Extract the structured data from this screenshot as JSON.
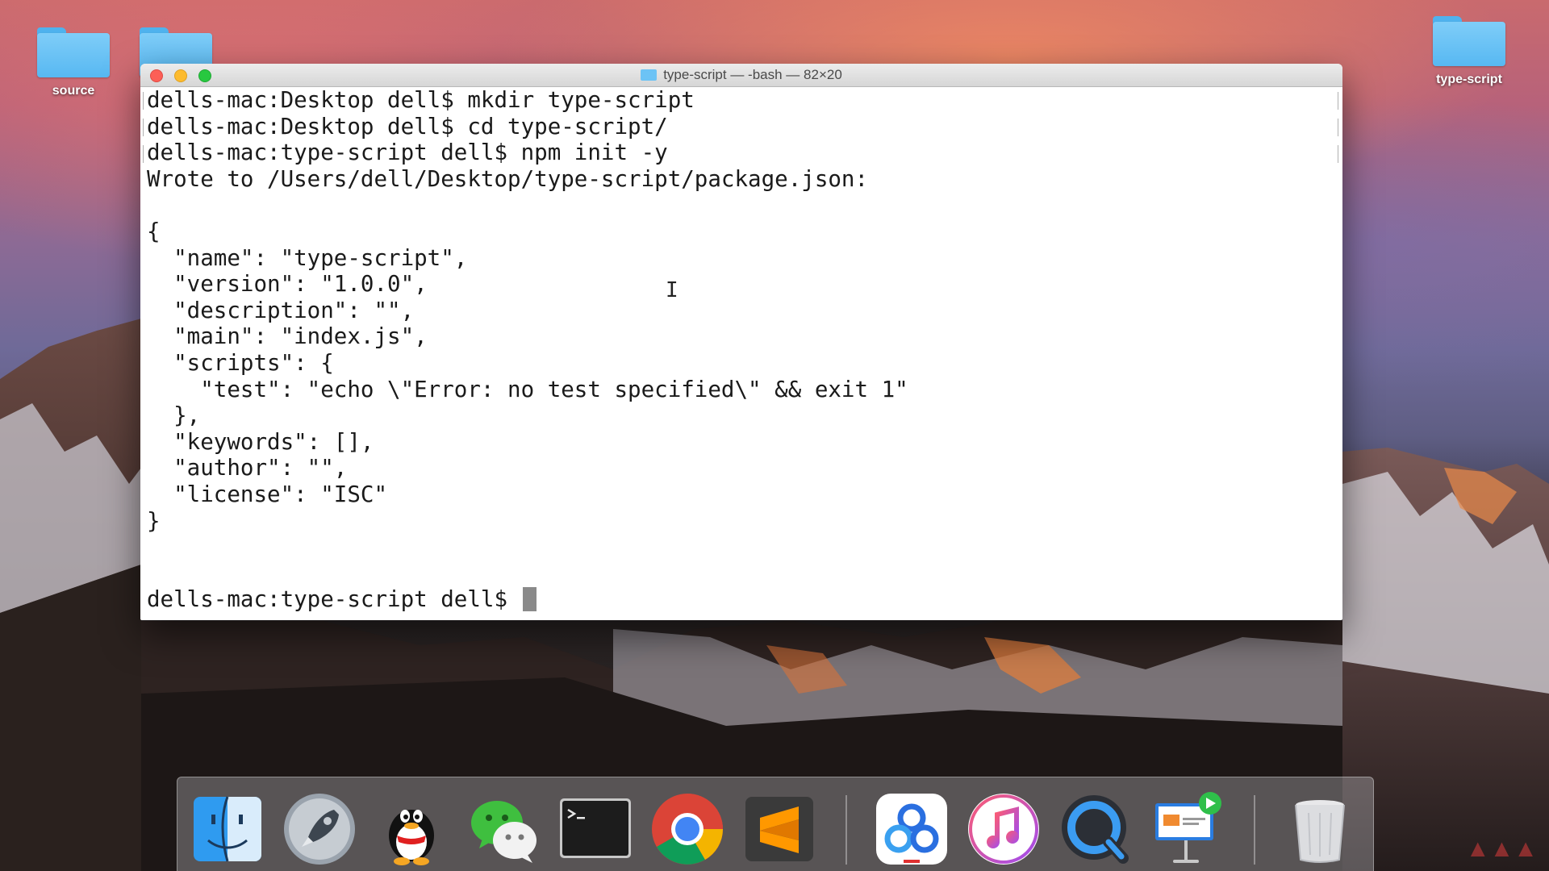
{
  "desktop": {
    "icons": [
      {
        "label": "source",
        "icon": "folder-icon"
      },
      {
        "label": "",
        "icon": "folder-icon"
      },
      {
        "label": "type-script",
        "icon": "folder-icon"
      }
    ]
  },
  "terminal": {
    "title": "type-script — -bash — 82×20",
    "lines": [
      "dells-mac:Desktop dell$ mkdir type-script",
      "dells-mac:Desktop dell$ cd type-script/",
      "dells-mac:type-script dell$ npm init -y",
      "Wrote to /Users/dell/Desktop/type-script/package.json:",
      "",
      "{",
      "  \"name\": \"type-script\",",
      "  \"version\": \"1.0.0\",",
      "  \"description\": \"\",",
      "  \"main\": \"index.js\",",
      "  \"scripts\": {",
      "    \"test\": \"echo \\\"Error: no test specified\\\" && exit 1\"",
      "  },",
      "  \"keywords\": [],",
      "  \"author\": \"\",",
      "  \"license\": \"ISC\"",
      "}",
      "",
      ""
    ],
    "prompt": "dells-mac:type-script dell$ "
  },
  "dock": {
    "apps": [
      {
        "name": "Finder",
        "icon": "finder-icon",
        "running": true
      },
      {
        "name": "Launchpad",
        "icon": "launchpad-rocket-icon",
        "running": false
      },
      {
        "name": "QQ",
        "icon": "qq-penguin-icon",
        "running": true
      },
      {
        "name": "WeChat",
        "icon": "wechat-icon",
        "running": true
      },
      {
        "name": "Terminal",
        "icon": "terminal-icon",
        "running": true
      },
      {
        "name": "Chrome",
        "icon": "chrome-icon",
        "running": true
      },
      {
        "name": "Sublime Text",
        "icon": "sublime-text-icon",
        "running": true
      },
      {
        "name": "Baidu Netdisk",
        "icon": "baidu-netdisk-icon",
        "running": true
      },
      {
        "name": "iTunes",
        "icon": "itunes-music-icon",
        "running": true
      },
      {
        "name": "QuickTime Player",
        "icon": "quicktime-icon",
        "running": true
      },
      {
        "name": "Keynote",
        "icon": "keynote-icon",
        "running": true
      },
      {
        "name": "Trash",
        "icon": "trash-icon",
        "running": false
      }
    ]
  },
  "colors": {
    "terminal_bg": "#ffffff",
    "terminal_text": "#1a1a1a",
    "folder_blue": "#57b8f2",
    "close": "#fc5f57",
    "minimize": "#fdbb2e",
    "zoom": "#28c840"
  }
}
